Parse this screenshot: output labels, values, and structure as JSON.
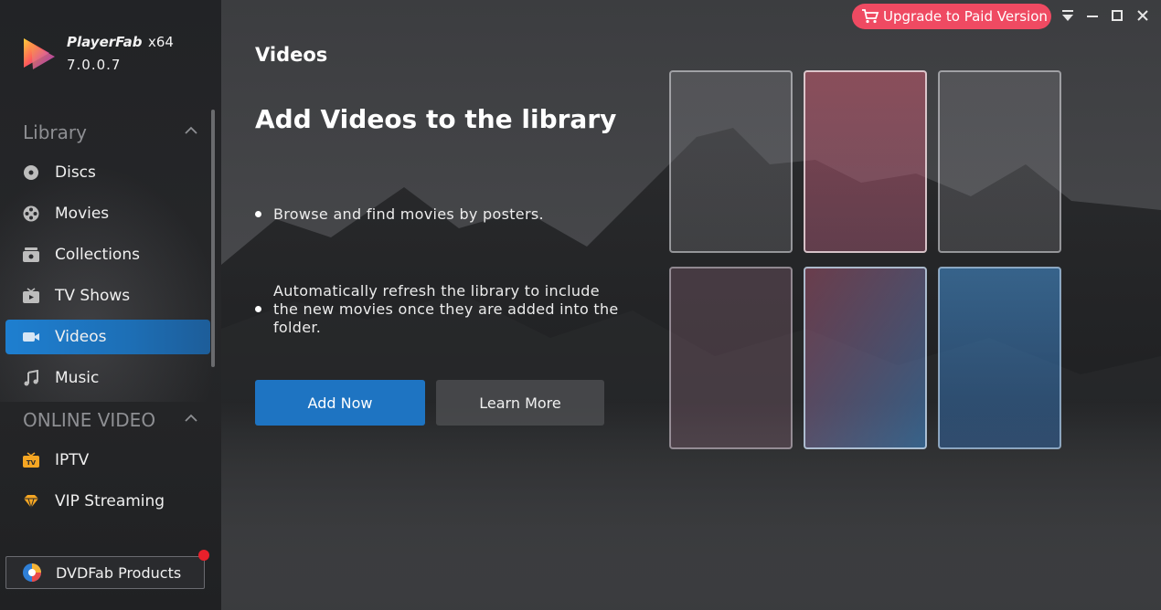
{
  "app": {
    "name": "PlayerFab",
    "arch": "x64",
    "version": "7.0.0.7"
  },
  "sidebar": {
    "library_title": "Library",
    "library_items": [
      {
        "label": "Discs",
        "icon": "disc-icon"
      },
      {
        "label": "Movies",
        "icon": "film-reel-icon"
      },
      {
        "label": "Collections",
        "icon": "collections-box-icon"
      },
      {
        "label": "TV Shows",
        "icon": "tv-icon"
      },
      {
        "label": "Videos",
        "icon": "video-camera-icon",
        "active": true
      },
      {
        "label": "Music",
        "icon": "music-note-icon"
      }
    ],
    "online_title": "ONLINE VIDEO",
    "online_items": [
      {
        "label": "IPTV",
        "icon": "iptv-icon"
      },
      {
        "label": "VIP Streaming",
        "icon": "diamond-icon"
      }
    ],
    "products_label": "DVDFab Products"
  },
  "topbar": {
    "upgrade_label": "Upgrade to Paid Version"
  },
  "main": {
    "page_title": "Videos",
    "headline": "Add Videos to the library",
    "bullets": [
      "Browse and find movies by posters.",
      "Automatically refresh the library to include the new movies once they are added into the folder."
    ],
    "add_now_label": "Add Now",
    "learn_more_label": "Learn More"
  },
  "colors": {
    "accent_blue": "#1e74c2",
    "upgrade_pink": "#ef4a62",
    "notification_red": "#e9202b"
  }
}
